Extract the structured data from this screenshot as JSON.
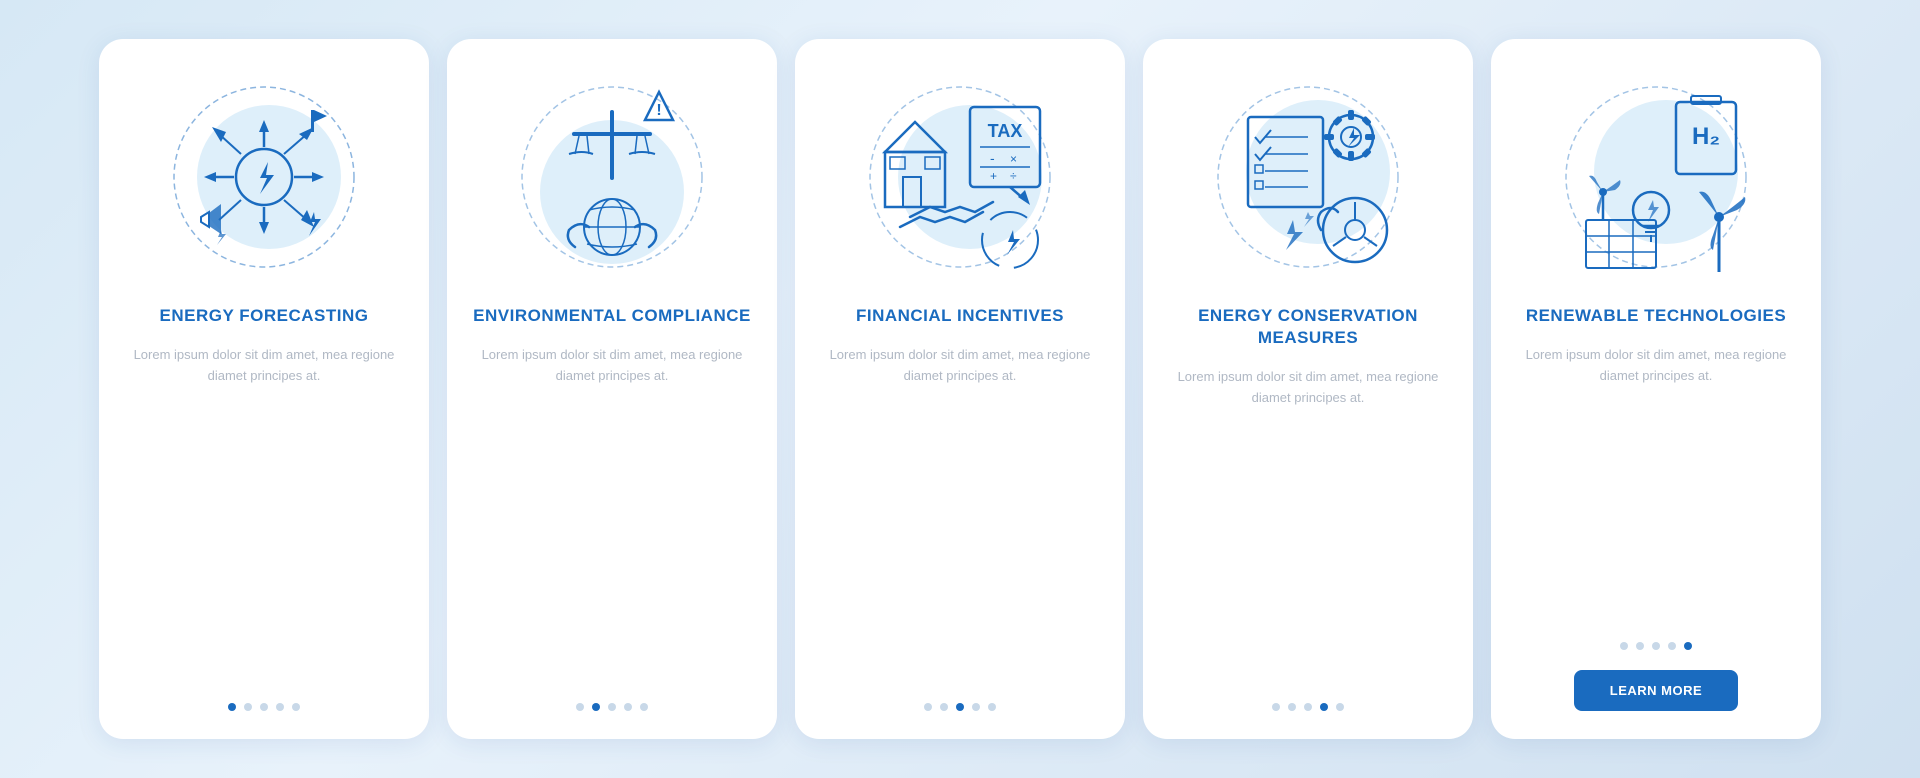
{
  "cards": [
    {
      "id": "energy-forecasting",
      "title": "ENERGY\nFORECASTING",
      "body_text": "Lorem ipsum dolor sit dim amet, mea regione diamet principes at.",
      "dots": [
        true,
        false,
        false,
        false,
        false
      ],
      "has_button": false
    },
    {
      "id": "environmental-compliance",
      "title": "ENVIRONMENTAL\nCOMPLIANCE",
      "body_text": "Lorem ipsum dolor sit dim amet, mea regione diamet principes at.",
      "dots": [
        false,
        true,
        false,
        false,
        false
      ],
      "has_button": false
    },
    {
      "id": "financial-incentives",
      "title": "FINANCIAL INCENTIVES",
      "body_text": "Lorem ipsum dolor sit dim amet, mea regione diamet principes at.",
      "dots": [
        false,
        false,
        true,
        false,
        false
      ],
      "has_button": false
    },
    {
      "id": "energy-conservation",
      "title": "ENERGY CONSERVATION\nMEASURES",
      "body_text": "Lorem ipsum dolor sit dim amet, mea regione diamet principes at.",
      "dots": [
        false,
        false,
        false,
        true,
        false
      ],
      "has_button": false
    },
    {
      "id": "renewable-technologies",
      "title": "RENEWABLE\nTECHNOLOGIES",
      "body_text": "Lorem ipsum dolor sit dim amet, mea regione diamet principes at.",
      "dots": [
        false,
        false,
        false,
        false,
        true
      ],
      "has_button": true,
      "button_label": "LEARN MORE"
    }
  ],
  "colors": {
    "primary": "#1a6bbf",
    "light_blue": "#d0e8f8",
    "icon_stroke": "#1a6bbf",
    "dot_active": "#1a6bbf",
    "dot_inactive": "#c8d8e8"
  }
}
